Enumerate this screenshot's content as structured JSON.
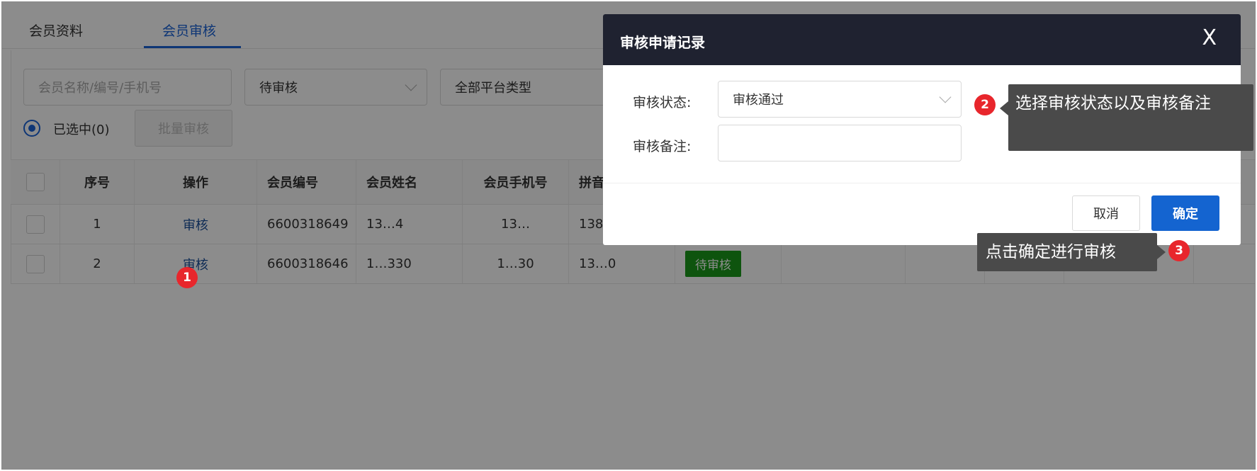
{
  "tabs": [
    {
      "label": "会员资料",
      "active": false
    },
    {
      "label": "会员审核",
      "active": true
    }
  ],
  "filters": {
    "search_placeholder": "会员名称/编号/手机号",
    "status_value": "待审核",
    "platform_value": "全部平台类型"
  },
  "selection": {
    "selected_label": "已选中(0)",
    "batch_button": "批量审核"
  },
  "table": {
    "headers": [
      "序号",
      "操作",
      "会员编号",
      "会员姓名",
      "会员手机号",
      "拼音"
    ],
    "rows": [
      {
        "index": "1",
        "action": "审核",
        "member_no": "6600318649",
        "name": "13…4",
        "phone": "13…",
        "extra": "138"
      },
      {
        "index": "2",
        "action": "审核",
        "member_no": "6600318646",
        "name": "1…330",
        "phone": "1…30",
        "extra": "13…0",
        "status": "待审核"
      }
    ]
  },
  "modal": {
    "title": "审核申请记录",
    "close": "X",
    "status_label": "审核状态:",
    "status_value": "审核通过",
    "remark_label": "审核备注:",
    "cancel": "取消",
    "confirm": "确定"
  },
  "annotations": {
    "m1": "1",
    "m2": "2",
    "m3": "3",
    "tip2": "选择审核状态以及审核备注",
    "tip3": "点击确定进行审核"
  },
  "colors": {
    "accent": "#1a63d8",
    "confirm": "#1464d0",
    "badge": "#1a9a1a",
    "marker": "#e8262c",
    "modal_header": "#1f2230"
  }
}
